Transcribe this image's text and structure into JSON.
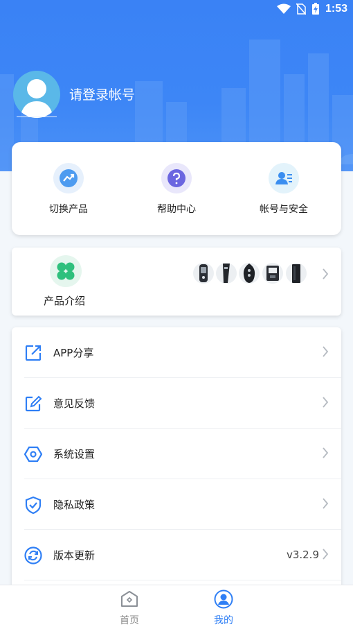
{
  "status": {
    "time": "1:53"
  },
  "profile": {
    "login_text": "请登录帐号"
  },
  "quick_actions": [
    {
      "label": "切换产品",
      "icon": "switch-product-icon"
    },
    {
      "label": "帮助中心",
      "icon": "help-icon"
    },
    {
      "label": "帐号与安全",
      "icon": "account-security-icon"
    }
  ],
  "product": {
    "label": "产品介绍",
    "icon": "clover-icon"
  },
  "menu": [
    {
      "label": "APP分享",
      "icon": "share-icon",
      "value": ""
    },
    {
      "label": "意见反馈",
      "icon": "feedback-icon",
      "value": ""
    },
    {
      "label": "系统设置",
      "icon": "settings-icon",
      "value": ""
    },
    {
      "label": "隐私政策",
      "icon": "privacy-shield-icon",
      "value": ""
    },
    {
      "label": "版本更新",
      "icon": "update-icon",
      "value": "v3.2.9"
    }
  ],
  "tabs": [
    {
      "label": "首页",
      "icon": "home-icon"
    },
    {
      "label": "我的",
      "icon": "profile-icon"
    }
  ],
  "colors": {
    "primary": "#2f7ff5",
    "header": "#3a82f5",
    "inactive_tab": "#888888"
  }
}
